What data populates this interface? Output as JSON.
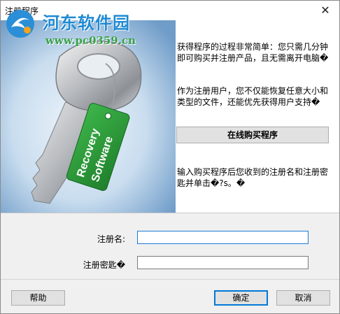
{
  "window": {
    "title": "注册程序",
    "close_glyph": "✕"
  },
  "watermark": {
    "name": "河东软件园",
    "url": "www.pc0359.cn"
  },
  "tag": {
    "line1": "Recovery",
    "line2": "Software"
  },
  "info": {
    "para1": "获得程序的过程非常简单：您只需几分钟即可购买并注册产品，且无需离开电脑�",
    "para2": "作为注册用户，您不仅能恢复任意大小和类型的文件，还能优先获得用户支持�",
    "buy_button": "在线购买程序",
    "para3": "输入购买程序后您收到的注册名和注册密匙并单击�?s。�"
  },
  "form": {
    "name_label": "注册名:",
    "name_value": "",
    "key_label": "注册密匙�",
    "key_value": ""
  },
  "footer": {
    "help": "帮助",
    "ok": "确定",
    "cancel": "取消"
  },
  "colors": {
    "watermark_name": "#1f8ad2",
    "watermark_url": "#3aa14b",
    "tag_green": "#2e9a3a",
    "focus_blue": "#0078d7"
  }
}
